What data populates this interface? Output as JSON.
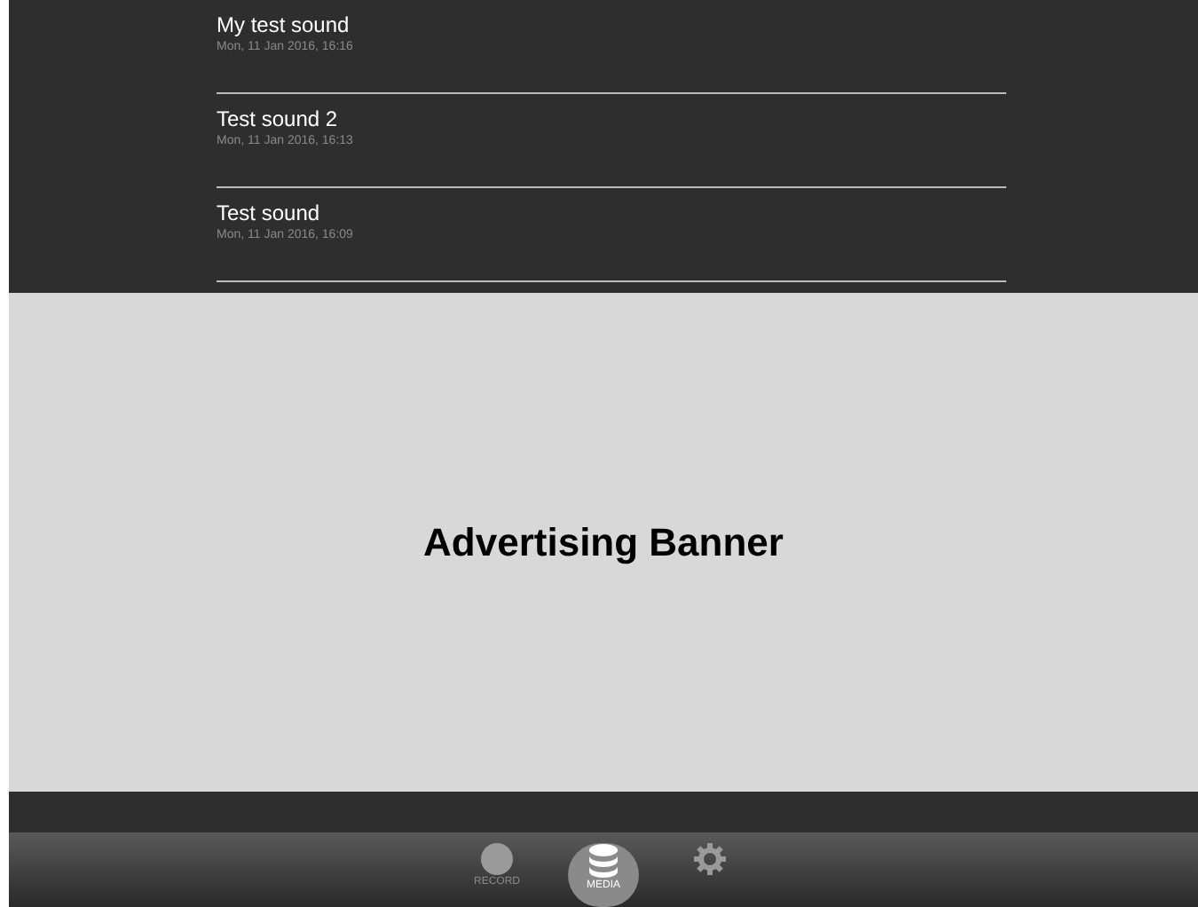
{
  "recordings": [
    {
      "title": "My test sound",
      "date": "Mon, 11 Jan 2016, 16:16"
    },
    {
      "title": "Test sound 2",
      "date": "Mon, 11 Jan 2016, 16:13"
    },
    {
      "title": "Test sound",
      "date": "Mon, 11 Jan 2016, 16:09"
    }
  ],
  "banner": {
    "text": "Advertising Banner"
  },
  "tab_bar": {
    "tabs": [
      {
        "kind": "record",
        "label": "RECORD",
        "selected": false
      },
      {
        "kind": "media",
        "label": "MEDIA",
        "selected": true
      },
      {
        "kind": "settings",
        "selected": false
      }
    ]
  }
}
